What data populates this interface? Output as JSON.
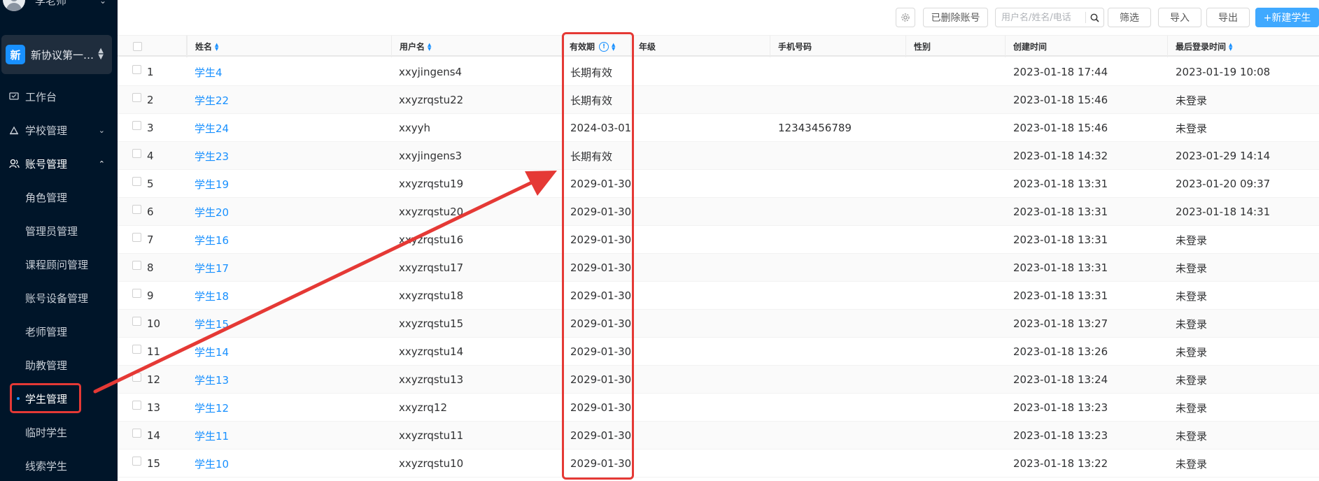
{
  "sidebar": {
    "user_name": "李老师",
    "org": {
      "badge": "新",
      "name": "新协议第一…"
    },
    "menu": [
      {
        "label": "工作台",
        "icon": "dashboard-icon",
        "caret": ""
      },
      {
        "label": "学校管理",
        "icon": "school-icon",
        "caret": "⌄"
      },
      {
        "label": "账号管理",
        "icon": "users-icon",
        "caret": "⌃"
      }
    ],
    "submenu": [
      {
        "label": "角色管理"
      },
      {
        "label": "管理员管理"
      },
      {
        "label": "课程顾问管理"
      },
      {
        "label": "账号设备管理"
      },
      {
        "label": "老师管理"
      },
      {
        "label": "助教管理"
      },
      {
        "label": "学生管理",
        "selected": true
      },
      {
        "label": "临时学生"
      },
      {
        "label": "线索学生"
      }
    ]
  },
  "toolbar": {
    "settings_icon": "gear-icon",
    "deleted_accounts_label": "已删除账号",
    "search_placeholder": "用户名/姓名/电话",
    "filter_label": "筛选",
    "import_label": "导入",
    "export_label": "导出",
    "new_student_label": "+新建学生"
  },
  "table": {
    "columns": {
      "name": "姓名",
      "username": "用户名",
      "validity": "有效期",
      "grade": "年级",
      "phone": "手机号码",
      "gender": "性别",
      "created": "创建时间",
      "last_login": "最后登录时间"
    },
    "rows": [
      {
        "index": "1",
        "name": "学生4",
        "username": "xxyjingens4",
        "validity": "长期有效",
        "grade": "",
        "phone": "",
        "gender": "",
        "created": "2023-01-18 17:44",
        "last_login": "2023-01-19 10:08"
      },
      {
        "index": "2",
        "name": "学生22",
        "username": "xxyzrqstu22",
        "validity": "长期有效",
        "grade": "",
        "phone": "",
        "gender": "",
        "created": "2023-01-18 15:46",
        "last_login": "未登录"
      },
      {
        "index": "3",
        "name": "学生24",
        "username": "xxyyh",
        "validity": "2024-03-01",
        "grade": "",
        "phone": "12343456789",
        "gender": "",
        "created": "2023-01-18 15:46",
        "last_login": "未登录"
      },
      {
        "index": "4",
        "name": "学生23",
        "username": "xxyjingens3",
        "validity": "长期有效",
        "grade": "",
        "phone": "",
        "gender": "",
        "created": "2023-01-18 14:32",
        "last_login": "2023-01-29 14:14"
      },
      {
        "index": "5",
        "name": "学生19",
        "username": "xxyzrqstu19",
        "validity": "2029-01-30",
        "grade": "",
        "phone": "",
        "gender": "",
        "created": "2023-01-18 13:31",
        "last_login": "2023-01-20 09:37"
      },
      {
        "index": "6",
        "name": "学生20",
        "username": "xxyzrqstu20",
        "validity": "2029-01-30",
        "grade": "",
        "phone": "",
        "gender": "",
        "created": "2023-01-18 13:31",
        "last_login": "2023-01-18 14:31"
      },
      {
        "index": "7",
        "name": "学生16",
        "username": "xxyzrqstu16",
        "validity": "2029-01-30",
        "grade": "",
        "phone": "",
        "gender": "",
        "created": "2023-01-18 13:31",
        "last_login": "未登录"
      },
      {
        "index": "8",
        "name": "学生17",
        "username": "xxyzrqstu17",
        "validity": "2029-01-30",
        "grade": "",
        "phone": "",
        "gender": "",
        "created": "2023-01-18 13:31",
        "last_login": "未登录"
      },
      {
        "index": "9",
        "name": "学生18",
        "username": "xxyzrqstu18",
        "validity": "2029-01-30",
        "grade": "",
        "phone": "",
        "gender": "",
        "created": "2023-01-18 13:31",
        "last_login": "未登录"
      },
      {
        "index": "10",
        "name": "学生15",
        "username": "xxyzrqstu15",
        "validity": "2029-01-30",
        "grade": "",
        "phone": "",
        "gender": "",
        "created": "2023-01-18 13:27",
        "last_login": "未登录"
      },
      {
        "index": "11",
        "name": "学生14",
        "username": "xxyzrqstu14",
        "validity": "2029-01-30",
        "grade": "",
        "phone": "",
        "gender": "",
        "created": "2023-01-18 13:26",
        "last_login": "未登录"
      },
      {
        "index": "12",
        "name": "学生13",
        "username": "xxyzrqstu13",
        "validity": "2029-01-30",
        "grade": "",
        "phone": "",
        "gender": "",
        "created": "2023-01-18 13:24",
        "last_login": "未登录"
      },
      {
        "index": "13",
        "name": "学生12",
        "username": "xxyzrq12",
        "validity": "2029-01-30",
        "grade": "",
        "phone": "",
        "gender": "",
        "created": "2023-01-18 13:23",
        "last_login": "未登录"
      },
      {
        "index": "14",
        "name": "学生11",
        "username": "xxyzrqstu11",
        "validity": "2029-01-30",
        "grade": "",
        "phone": "",
        "gender": "",
        "created": "2023-01-18 13:23",
        "last_login": "未登录"
      },
      {
        "index": "15",
        "name": "学生10",
        "username": "xxyzrqstu10",
        "validity": "2029-01-30",
        "grade": "",
        "phone": "",
        "gender": "",
        "created": "2023-01-18 13:22",
        "last_login": "未登录"
      }
    ]
  },
  "colors": {
    "sidebar_bg": "#001529",
    "accent": "#1890ff",
    "annotation": "#e53935"
  }
}
